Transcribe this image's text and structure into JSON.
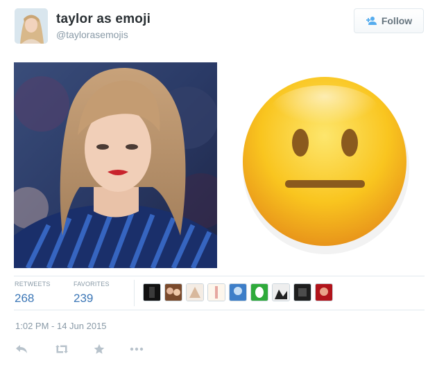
{
  "tweet": {
    "user": {
      "name": "taylor as emoji",
      "handle": "@taylorasemojis"
    },
    "follow_label": "Follow",
    "media": [
      {
        "kind": "photo",
        "description_icon": "portrait-photo"
      },
      {
        "kind": "emoji",
        "icon": "neutral-face-emoji"
      }
    ],
    "stats": {
      "retweets_label": "RETWEETS",
      "retweets_value": "268",
      "favorites_label": "FAVORITES",
      "favorites_value": "239"
    },
    "favoriters_count": 9,
    "timestamp": "1:02 PM - 14 Jun 2015",
    "actions": [
      "reply-icon",
      "retweet-icon",
      "favorite-icon",
      "more-icon"
    ]
  },
  "colors": {
    "link_blue": "#3b76b6",
    "muted": "#8899a6",
    "text": "#292f33",
    "border": "#e1e8ed",
    "emoji_yellow": "#f9c51f",
    "emoji_dark": "#8a5a1e"
  }
}
